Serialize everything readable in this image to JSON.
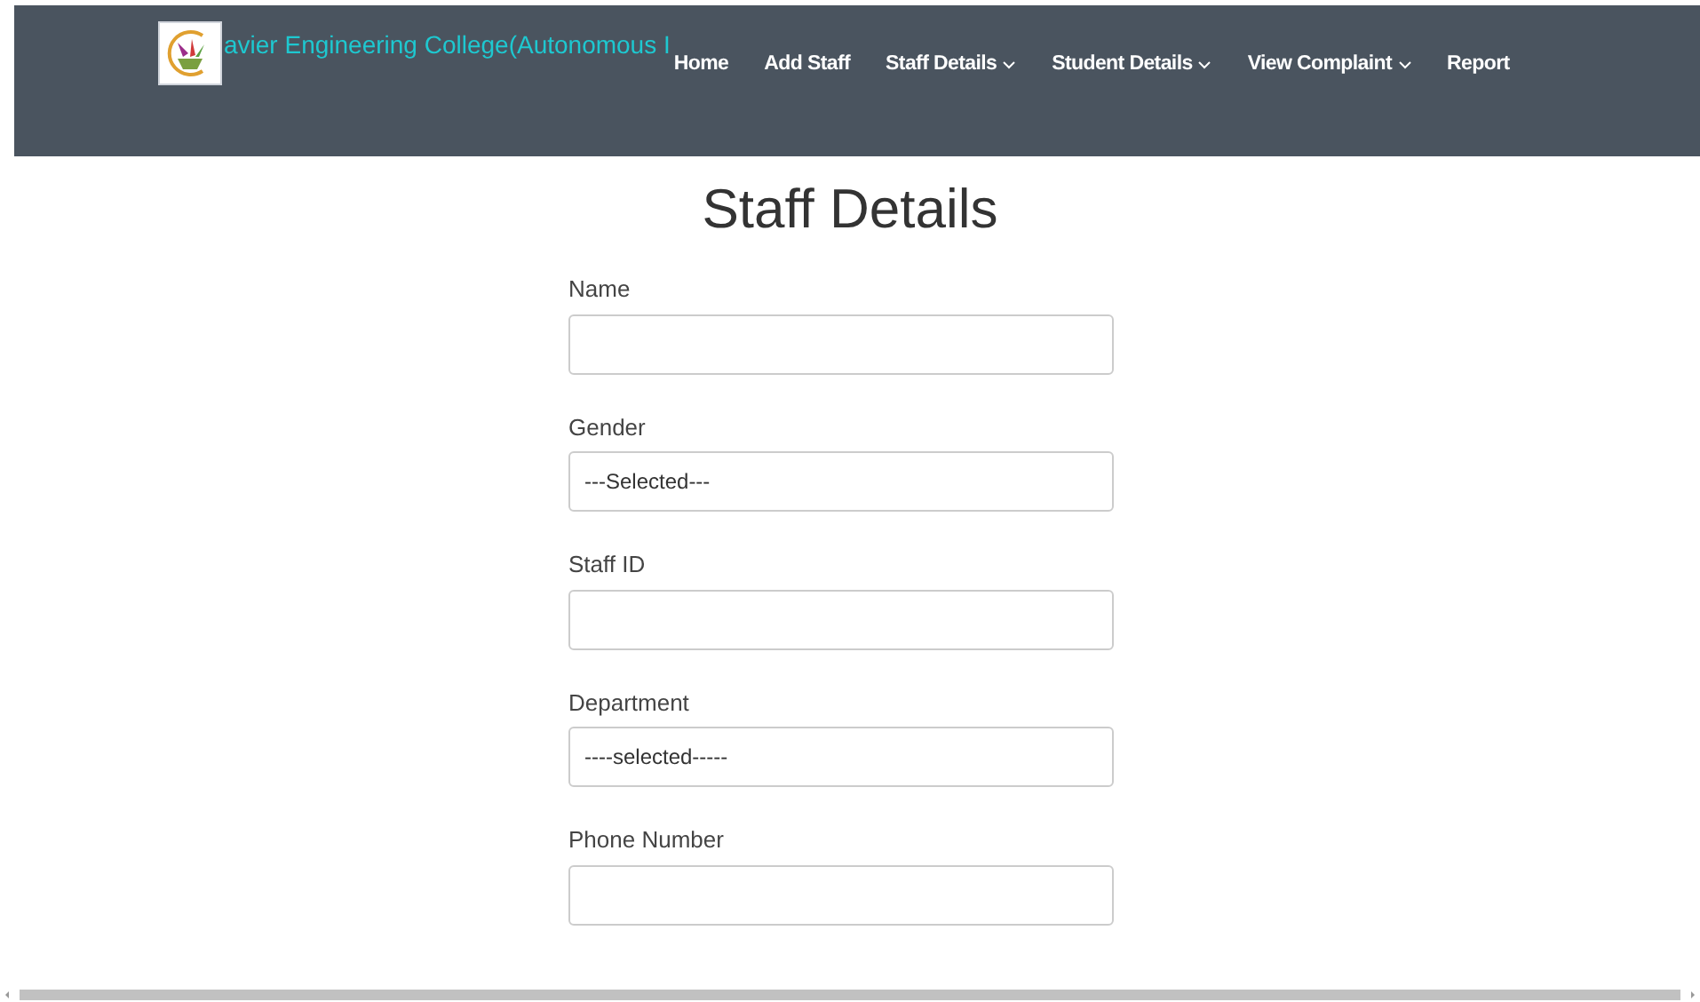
{
  "header": {
    "brand": "avier Engineering College(Autonomous I",
    "nav": [
      {
        "label": "Home",
        "dropdown": false
      },
      {
        "label": "Add Staff",
        "dropdown": false
      },
      {
        "label": "Staff Details",
        "dropdown": true
      },
      {
        "label": "Student Details",
        "dropdown": true
      },
      {
        "label": "View Complaint",
        "dropdown": true
      },
      {
        "label": "Report",
        "dropdown": false
      }
    ]
  },
  "title": "Staff Details",
  "fields": [
    {
      "label": "Name",
      "kind": "input"
    },
    {
      "label": "Gender",
      "kind": "select",
      "value": "---Selected---"
    },
    {
      "label": "Staff ID",
      "kind": "input"
    },
    {
      "label": "Department",
      "kind": "select",
      "value": "----selected-----"
    },
    {
      "label": "Phone Number",
      "kind": "input"
    }
  ]
}
